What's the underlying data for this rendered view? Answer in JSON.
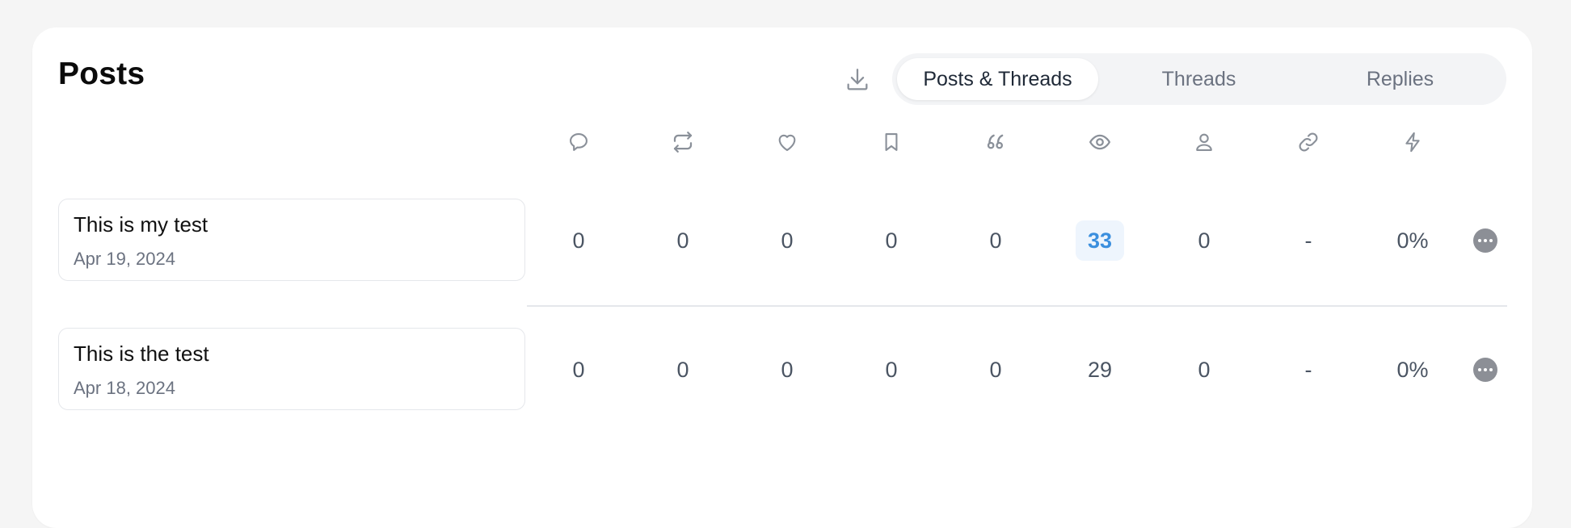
{
  "title": "Posts",
  "tabs": [
    {
      "label": "Posts & Threads",
      "active": true
    },
    {
      "label": "Threads",
      "active": false
    },
    {
      "label": "Replies",
      "active": false
    }
  ],
  "columns": [
    {
      "icon": "comment-icon"
    },
    {
      "icon": "repost-icon"
    },
    {
      "icon": "heart-icon"
    },
    {
      "icon": "bookmark-icon"
    },
    {
      "icon": "quote-icon"
    },
    {
      "icon": "eye-icon"
    },
    {
      "icon": "user-icon"
    },
    {
      "icon": "link-icon"
    },
    {
      "icon": "lightning-icon"
    }
  ],
  "posts": [
    {
      "title": "This is my test",
      "date": "Apr 19, 2024",
      "stats": [
        "0",
        "0",
        "0",
        "0",
        "0",
        "33",
        "0",
        "-",
        "0%"
      ],
      "highlight_index": 5
    },
    {
      "title": "This is the test",
      "date": "Apr 18, 2024",
      "stats": [
        "0",
        "0",
        "0",
        "0",
        "0",
        "29",
        "0",
        "-",
        "0%"
      ],
      "highlight_index": -1
    }
  ],
  "colors": {
    "accent": "#3b8fde",
    "accent_bg": "#eef5fd",
    "muted_text": "#6b7280",
    "icon": "#8a9099"
  }
}
